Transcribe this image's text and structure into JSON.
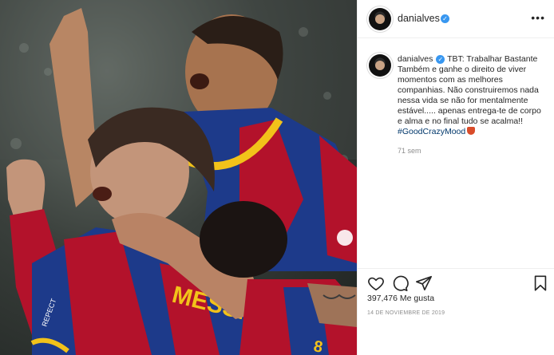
{
  "author": {
    "username": "danialves",
    "verified": true
  },
  "post": {
    "caption_text": "TBT: Trabalhar Bastante Também e ganhe o direito de viver momentos com as melhores companhias. Não construiremos nada nessa vida se não for mentalmente estável..... apenas entrega-te de corpo e alma e no final tudo se acalma!! ",
    "hashtag": "#GoodCrazyMood",
    "time_ago": "71 sem",
    "likes_count": "397,476",
    "likes_label": "Me gusta",
    "date": "14 DE NOVIEMBRE DE 2019"
  },
  "photo": {
    "jersey_text_1": "MESSI",
    "jersey_text_2": "REPECT"
  },
  "icons": {
    "more": "more-options-icon",
    "like": "heart-icon",
    "comment": "comment-icon",
    "share": "share-icon",
    "save": "bookmark-icon"
  },
  "colors": {
    "accent_blue": "#3897f0",
    "hashtag": "#00376b",
    "muted": "#8e8e8e",
    "barca_red": "#b3122b",
    "barca_blue": "#1d3a8a",
    "barca_yellow": "#f2c21a"
  }
}
